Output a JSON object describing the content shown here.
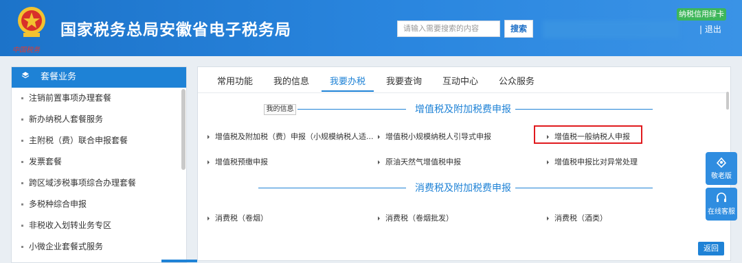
{
  "header": {
    "emblem_text": "中国税务",
    "title": "国家税务总局安徽省电子税务局",
    "search_placeholder": "请输入需要搜索的内容",
    "search_button": "搜索",
    "badge": "纳税信用绿卡",
    "logout": "| 退出"
  },
  "sidebar": {
    "title": "套餐业务",
    "items": [
      "注销前置事项办理套餐",
      "新办纳税人套餐服务",
      "主附税（费）联合申报套餐",
      "发票套餐",
      "跨区域涉税事项综合办理套餐",
      "多税种综合申报",
      "非税收入划转业务专区",
      "小微企业套餐式服务"
    ]
  },
  "tabs": [
    "常用功能",
    "我的信息",
    "我要办税",
    "我要查询",
    "互动中心",
    "公众服务"
  ],
  "active_tab": "我要办税",
  "tooltip": "我的信息",
  "sections": [
    {
      "title": "增值税及附加税费申报",
      "links": [
        "增值税及附加税（费）申报（小规模纳税人适...",
        "增值税小规模纳税人引导式申报",
        "增值税一般纳税人申报",
        "增值税预缴申报",
        "原油天然气增值税申报",
        "增值税申报比对异常处理"
      ]
    },
    {
      "title": "消费税及附加税费申报",
      "links": [
        "消费税（卷烟）",
        "消费税（卷烟批发）",
        "消费税（酒类）"
      ]
    }
  ],
  "back_button": "返回",
  "float_buttons": [
    "敬老版",
    "在线客服"
  ],
  "colors": {
    "accent": "#1e82d6",
    "highlight": "#e0191d",
    "badge": "#3db65a"
  }
}
